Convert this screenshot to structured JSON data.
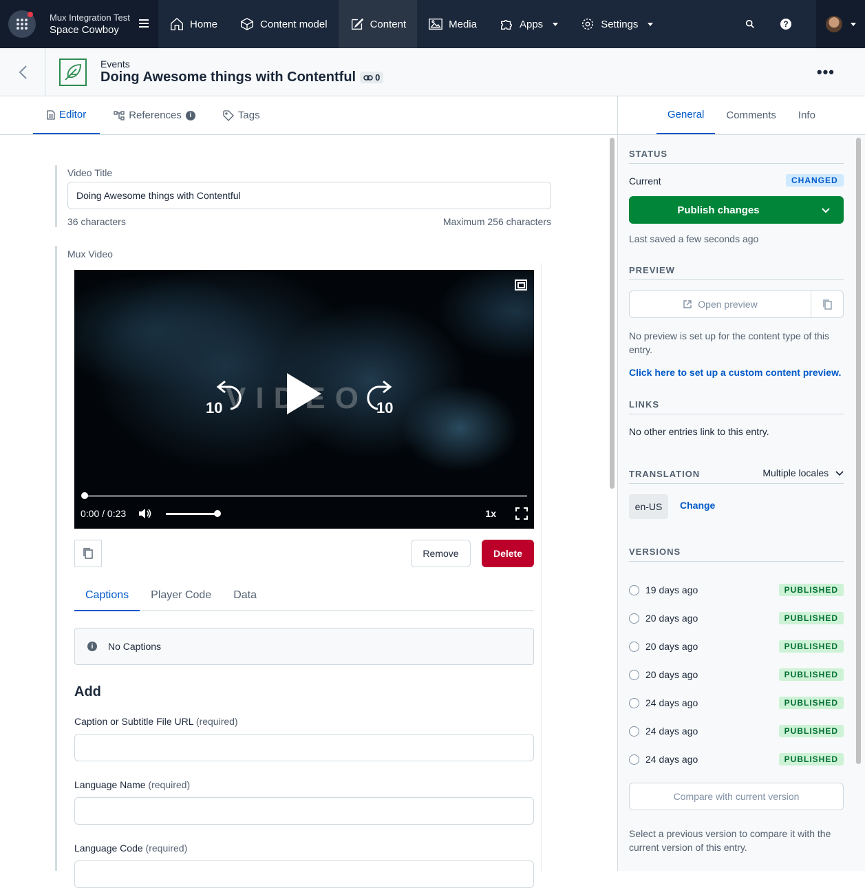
{
  "topnav": {
    "org_name": "Mux Integration Test",
    "space_name": "Space Cowboy",
    "items": [
      {
        "label": "Home",
        "icon": "home-icon"
      },
      {
        "label": "Content model",
        "icon": "box-icon"
      },
      {
        "label": "Content",
        "icon": "edit-icon",
        "active": true
      },
      {
        "label": "Media",
        "icon": "image-icon"
      },
      {
        "label": "Apps",
        "icon": "puzzle-icon",
        "dropdown": true
      },
      {
        "label": "Settings",
        "icon": "gear-icon",
        "dropdown": true
      }
    ],
    "help_glyph": "?"
  },
  "entry": {
    "content_type": "Events",
    "title": "Doing Awesome things with Contentful",
    "link_count": "0"
  },
  "editor_tabs": {
    "editor": "Editor",
    "references": "References",
    "tags": "Tags"
  },
  "fields": {
    "video_title": {
      "label": "Video Title",
      "value": "Doing Awesome things with Contentful",
      "char_count": "36 characters",
      "max": "Maximum 256 characters"
    },
    "mux_video": {
      "label": "Mux Video",
      "player": {
        "time": "0:00 / 0:23",
        "speed": "1x",
        "skip_back": "10",
        "skip_forward": "10",
        "progress": 0,
        "volume": 1.0,
        "overlay_text": "VIDEO"
      },
      "remove_label": "Remove",
      "delete_label": "Delete",
      "tabs": [
        "Captions",
        "Player Code",
        "Data"
      ],
      "no_captions": "No Captions",
      "add_heading": "Add",
      "form": [
        {
          "label": "Caption or Subtitle File URL",
          "req": "(required)"
        },
        {
          "label": "Language Name",
          "req": "(required)"
        },
        {
          "label": "Language Code",
          "req": "(required)"
        }
      ]
    }
  },
  "sidebar": {
    "tabs": [
      "General",
      "Comments",
      "Info"
    ],
    "status": {
      "heading": "STATUS",
      "current_label": "Current",
      "badge": "CHANGED",
      "publish_label": "Publish changes",
      "last_saved": "Last saved a few seconds ago"
    },
    "preview": {
      "heading": "PREVIEW",
      "open_label": "Open preview",
      "note": "No preview is set up for the content type of this entry.",
      "setup_link": "Click here to set up a custom content preview."
    },
    "links": {
      "heading": "LINKS",
      "note": "No other entries link to this entry."
    },
    "translation": {
      "heading": "TRANSLATION",
      "mode": "Multiple locales",
      "locale": "en-US",
      "change_label": "Change"
    },
    "versions": {
      "heading": "VERSIONS",
      "items": [
        {
          "when": "19 days ago",
          "status": "PUBLISHED"
        },
        {
          "when": "20 days ago",
          "status": "PUBLISHED"
        },
        {
          "when": "20 days ago",
          "status": "PUBLISHED"
        },
        {
          "when": "20 days ago",
          "status": "PUBLISHED"
        },
        {
          "when": "24 days ago",
          "status": "PUBLISHED"
        },
        {
          "when": "24 days ago",
          "status": "PUBLISHED"
        },
        {
          "when": "24 days ago",
          "status": "PUBLISHED"
        }
      ],
      "compare_label": "Compare with current version",
      "compare_note": "Select a previous version to compare it with the current version of this entry."
    }
  },
  "colors": {
    "nav_bg": "#1b273a",
    "accent": "#0059c8",
    "publish_green": "#008539",
    "delete_red": "#bd002a"
  }
}
